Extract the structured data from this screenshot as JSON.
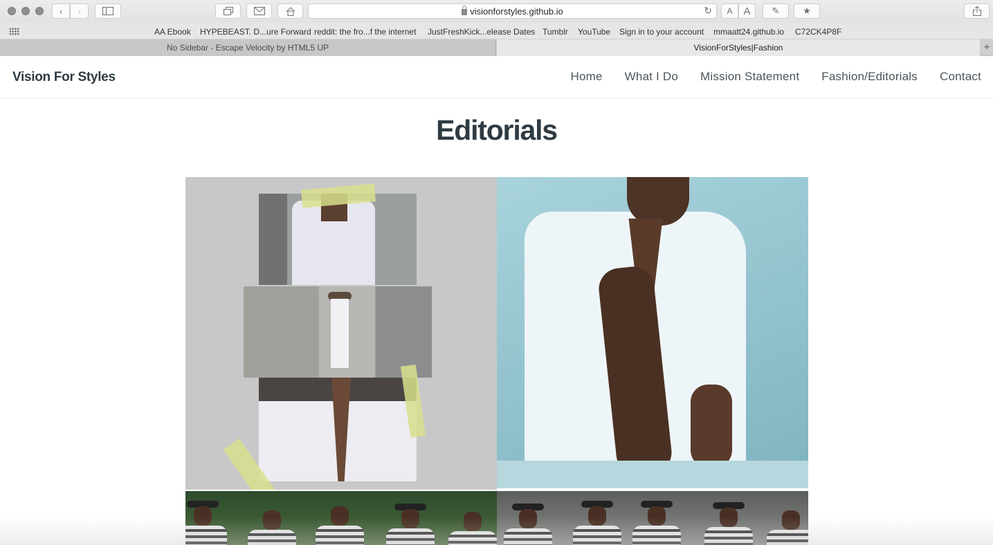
{
  "browser": {
    "url": "visionforstyles.github.io",
    "reader_small": "A",
    "reader_large": "A",
    "bookmarks": [
      "AA Ebook",
      "HYPEBEAST. D...ure Forward",
      "reddit: the fro...f the internet",
      "JustFreshKick...elease Dates",
      "Tumblr",
      "YouTube",
      "Sign in to your account",
      "mmaatt24.github.io",
      "C72CK4P8F"
    ],
    "tabs": [
      {
        "label": "No Sidebar - Escape Velocity by HTML5 UP",
        "active": false
      },
      {
        "label": "VisionForStyles|Fashion",
        "active": true
      }
    ],
    "new_tab": "+"
  },
  "site": {
    "logo": "Vision For Styles",
    "nav": [
      "Home",
      "What I Do",
      "Mission Statement",
      "Fashion/Editorials",
      "Contact"
    ],
    "page_title": "Editorials"
  },
  "colors": {
    "heading": "#2f3b42",
    "nav_text": "#4c565c"
  }
}
